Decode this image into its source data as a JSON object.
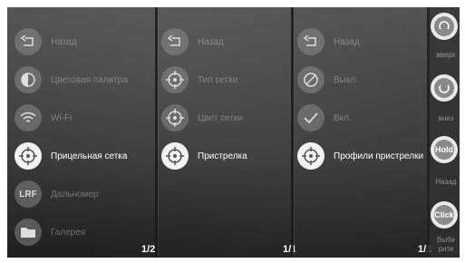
{
  "panel1": {
    "items": [
      {
        "label": "Назад",
        "icon": "back-icon",
        "active": false
      },
      {
        "label": "Цветовая палитра",
        "icon": "palette-icon",
        "active": false
      },
      {
        "label": "Wi-Fi",
        "icon": "wifi-icon",
        "active": false
      },
      {
        "label": "Прицельная сетка",
        "icon": "reticle-icon",
        "active": true
      },
      {
        "label": "Дальномер",
        "icon": "lrf-icon",
        "active": false
      },
      {
        "label": "Галерея",
        "icon": "gallery-icon",
        "active": false
      }
    ],
    "page": "1/2"
  },
  "panel2": {
    "items": [
      {
        "label": "Назад",
        "icon": "back-icon",
        "active": false
      },
      {
        "label": "Тип сетки",
        "icon": "reticle-icon",
        "active": false
      },
      {
        "label": "Цвет сетки",
        "icon": "reticle-icon",
        "active": false
      },
      {
        "label": "Пристрелка",
        "icon": "reticle-icon",
        "active": true
      }
    ],
    "page": "1/1"
  },
  "panel3": {
    "items": [
      {
        "label": "Назад",
        "icon": "back-icon",
        "active": false
      },
      {
        "label": "Выкл.",
        "icon": "off-icon",
        "active": false
      },
      {
        "label": "Вкл.",
        "icon": "check-icon",
        "active": false
      },
      {
        "label": "Профили пристрелки",
        "icon": "reticle-icon",
        "active": true
      }
    ],
    "page": "1/1"
  },
  "side": {
    "up_label": "вверх",
    "down_label": "вниз",
    "hold_text": "Hold",
    "back_label": "Назад",
    "click_text": "Click",
    "select_label_1": "Выбе",
    "select_label_2": "рите"
  },
  "colors": {
    "active": "#f2f2f2",
    "inactive": "#969696"
  }
}
